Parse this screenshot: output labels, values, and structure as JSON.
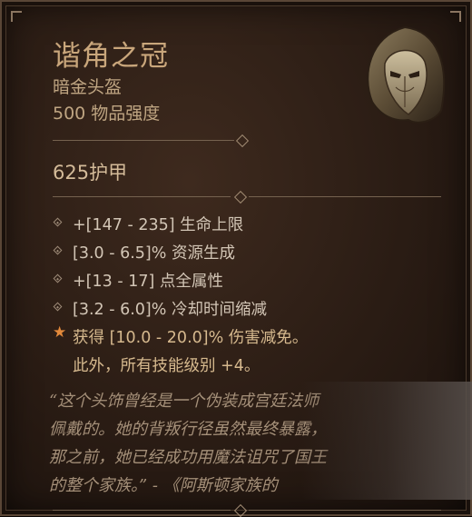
{
  "item": {
    "name": "谐角之冠",
    "type": "暗金头盔",
    "item_power": "500 物品强度",
    "armor": "625护甲"
  },
  "affixes": [
    "+[147 - 235] 生命上限",
    "[3.0 - 6.5]% 资源生成",
    "+[13 - 17] 点全属性",
    "[3.2 - 6.0]% 冷却时间缩减"
  ],
  "legendary": {
    "icon": "star-icon",
    "line1": "获得 [10.0 - 20.0]% 伤害减免。",
    "line2": "此外，所有技能级别 +4。"
  },
  "flavor": {
    "line1": "“这个头饰曾经是一个伪装成宫廷法师",
    "line2": "佩戴的。她的背叛行径虽然最终暴露，",
    "line3": "那之前，她已经成功用魔法诅咒了国王",
    "line4": "的整个家族。” - 《阿斯顿家族的"
  },
  "colors": {
    "title": "#c9a67b",
    "legendary_star": "#e3893b",
    "background": "#2a1c14"
  },
  "icons": {
    "helm": "hooded-helm-icon",
    "affix_bullet": "diamond-bullet-icon"
  }
}
